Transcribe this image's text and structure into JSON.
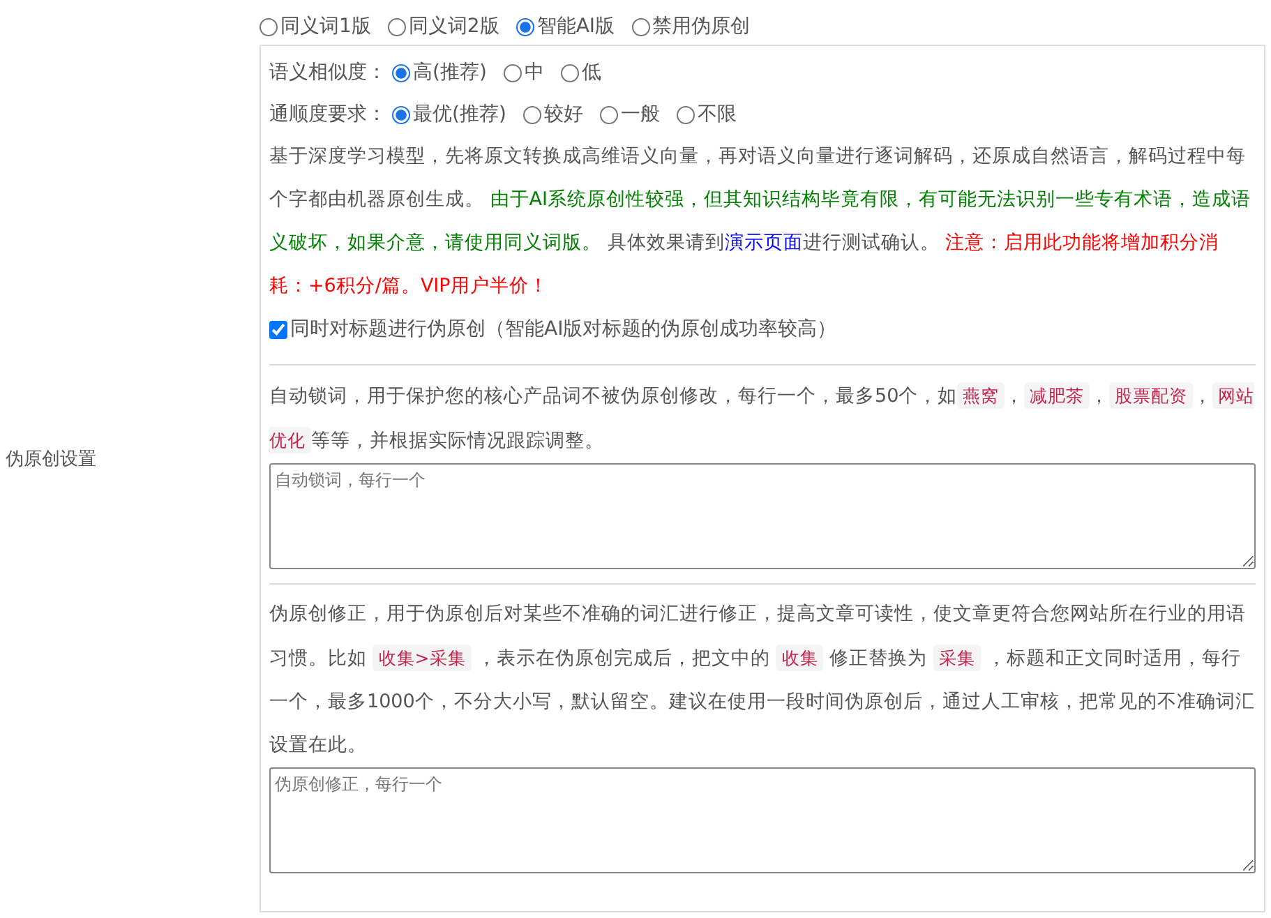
{
  "section_label": "伪原创设置",
  "mode_options": [
    {
      "label": "同义词1版",
      "selected": false
    },
    {
      "label": "同义词2版",
      "selected": false
    },
    {
      "label": "智能AI版",
      "selected": true
    },
    {
      "label": "禁用伪原创",
      "selected": false
    }
  ],
  "similarity": {
    "label": "语义相似度：",
    "options": [
      {
        "label": "高(推荐)",
        "selected": true
      },
      {
        "label": "中",
        "selected": false
      },
      {
        "label": "低",
        "selected": false
      }
    ]
  },
  "fluency": {
    "label": "通顺度要求：",
    "options": [
      {
        "label": "最优(推荐)",
        "selected": true
      },
      {
        "label": "较好",
        "selected": false
      },
      {
        "label": "一般",
        "selected": false
      },
      {
        "label": "不限",
        "selected": false
      }
    ]
  },
  "description": [
    {
      "kind": "text",
      "text": "基于深度学习模型，先将原文转换成高维语义向量，再对语义向量进行逐词解码，还原成自然语言，解码过程中每个字都由机器原创生成。 "
    },
    {
      "kind": "note",
      "text": "由于AI系统原创性较强，但其知识结构毕竟有限，有可能无法识别一些专有术语，造成语义破坏，如果介意，请使用同义词版。"
    },
    {
      "kind": "text",
      "text": " 具体效果请到"
    },
    {
      "kind": "link",
      "text": "演示页面"
    },
    {
      "kind": "text",
      "text": "进行测试确认。 "
    },
    {
      "kind": "warning",
      "text": "注意：启用此功能将增加积分消耗：+6积分/篇。VIP用户半价！"
    }
  ],
  "title_checkbox": {
    "label": "同时对标题进行伪原创（智能AI版对标题的伪原创成功率较高）",
    "checked": true
  },
  "lock_words": {
    "description": [
      {
        "kind": "text",
        "text": "自动锁词，用于保护您的核心产品词不被伪原创修改，每行一个，最多50个，如"
      },
      {
        "kind": "code",
        "text": "燕窝"
      },
      {
        "kind": "text",
        "text": "，"
      },
      {
        "kind": "code",
        "text": "减肥茶"
      },
      {
        "kind": "text",
        "text": "，"
      },
      {
        "kind": "code",
        "text": "股票配资"
      },
      {
        "kind": "text",
        "text": "，"
      },
      {
        "kind": "code",
        "text": "网站优化"
      },
      {
        "kind": "text",
        "text": "等等，并根据实际情况跟踪调整。"
      }
    ],
    "placeholder": "自动锁词，每行一个"
  },
  "correction": {
    "description": [
      {
        "kind": "text",
        "text": "伪原创修正，用于伪原创后对某些不准确的词汇进行修正，提高文章可读性，使文章更符合您网站所在行业的用语习惯。比如 "
      },
      {
        "kind": "code",
        "text": "收集>采集"
      },
      {
        "kind": "text",
        "text": " ，表示在伪原创完成后，把文中的 "
      },
      {
        "kind": "code",
        "text": "收集"
      },
      {
        "kind": "text",
        "text": " 修正替换为 "
      },
      {
        "kind": "code",
        "text": "采集"
      },
      {
        "kind": "text",
        "text": " ，标题和正文同时适用，每行一个，最多1000个，不分大小写，默认留空。建议在使用一段时间伪原创后，通过人工审核，把常见的不准确词汇设置在此。"
      }
    ],
    "placeholder": "伪原创修正，每行一个"
  }
}
